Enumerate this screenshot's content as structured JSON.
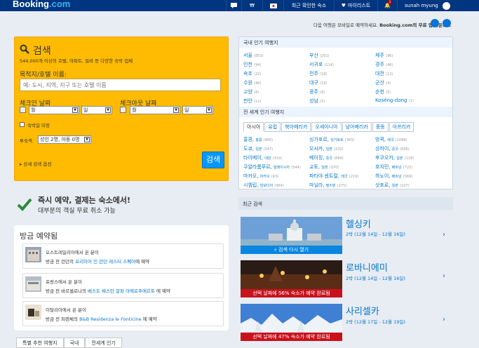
{
  "header": {
    "logo_main": "Booking",
    "logo_dot": ".com",
    "flag_icon": "🇰🇷",
    "currency": "₩",
    "recently_viewed": "최근 확인한 숙소",
    "wishlist": "마이리스트",
    "notif_count": "1",
    "user": "sunah myung"
  },
  "app_note": {
    "text_pre": "다음 여행은 모바일로 예약하세요. ",
    "brand": "Booking.com",
    "text_post": "의 무료 앱 다운로드"
  },
  "search": {
    "title": "검색",
    "subtitle": "544,000개 이상의 호텔, 아파트, 빌라 등 다양한 숙박 업체",
    "dest_label": "목적지/호텔 이름:",
    "dest_placeholder": "예: 도시, 지역, 지구 또는 호텔 이름",
    "checkin_label": "체크인 날짜",
    "checkout_label": "체크아웃 날짜",
    "month_sel": "월",
    "day_sel": "일",
    "undecided": "숙박일 미정",
    "guests_label": "투숙객",
    "guests_value": "성인 2명, 아동 0명",
    "advanced": "상세 검색 옵션",
    "button": "검색"
  },
  "promo": {
    "line1": "즉시 예약, 결제는 숙소에서!",
    "line2": "대부분의 객실 무료 취소 가능"
  },
  "recent_bookings": {
    "title": "방금 예약됨",
    "items": [
      {
        "origin": "오스트레일리아에서 온 분이",
        "pre": "방금 전 런던의 ",
        "link": "프리미어 인 런던 레스터 스퀘어",
        "post": "에 예약"
      },
      {
        "origin": "프랑스에서 온 분이",
        "pre": "방금 전 바르셀로나의 ",
        "link": "베스트 웨스턴 알파 아에로푸에르토",
        "post": " 에 예약"
      },
      {
        "origin": "이탈리아에서 온 분이",
        "pre": "방금 전 피렌체의 ",
        "link": "B&B Residenza le Fonticine",
        "post": " 에 예약"
      }
    ]
  },
  "bottom_tabs": [
    "특별 추천 여행지",
    "국내",
    "전세계 인기"
  ],
  "domestic": {
    "title": "국내 인기 여행지",
    "cities": [
      {
        "name": "서울",
        "count": "(853)"
      },
      {
        "name": "부산",
        "count": "(201)"
      },
      {
        "name": "제주",
        "count": "(96)"
      },
      {
        "name": "인천",
        "count": "(94)"
      },
      {
        "name": "서귀포",
        "count": "(114)"
      },
      {
        "name": "경주",
        "count": "(46)"
      },
      {
        "name": "속초",
        "count": "(22)"
      },
      {
        "name": "전주",
        "count": "(18)"
      },
      {
        "name": "대전",
        "count": "(12)"
      },
      {
        "name": "수원",
        "count": "(40)"
      },
      {
        "name": "대구",
        "count": "(19)"
      },
      {
        "name": "군산",
        "count": "(4)"
      },
      {
        "name": "고양",
        "count": "(8)"
      },
      {
        "name": "광주",
        "count": "(8)"
      },
      {
        "name": "순천",
        "count": "(5)"
      },
      {
        "name": "천안",
        "count": "(11)"
      },
      {
        "name": "성남",
        "count": "(5)"
      },
      {
        "name": "Koséng-dong",
        "count": "(1)"
      }
    ]
  },
  "world": {
    "title": "전 세계 인기 여행지",
    "tabs": [
      "아시아",
      "유럽",
      "북아메리카",
      "오세아니아",
      "남아메리카",
      "중동",
      "아프리카"
    ],
    "cities": [
      {
        "name": "홍콩,",
        "sub": "홍콩",
        "count": "(400)"
      },
      {
        "name": "싱가포르,",
        "sub": "싱가포르",
        "count": "(365)"
      },
      {
        "name": "방콕,",
        "sub": "태국",
        "count": "(1099)"
      },
      {
        "name": "도쿄,",
        "sub": "일본",
        "count": "(547)"
      },
      {
        "name": "오사카,",
        "sub": "일본",
        "count": "(232)"
      },
      {
        "name": "상하이,",
        "sub": "중국",
        "count": "(656)"
      },
      {
        "name": "타이베이,",
        "sub": "대만",
        "count": "(319)"
      },
      {
        "name": "베이징,",
        "sub": "중국",
        "count": "(664)"
      },
      {
        "name": "후쿠오카,",
        "sub": "일본",
        "count": "(118)"
      },
      {
        "name": "쿠알라룸푸르,",
        "sub": "말레이시아",
        "count": "(544)"
      },
      {
        "name": "교토,",
        "sub": "일본",
        "count": "(370)"
      },
      {
        "name": "호치민,",
        "sub": "베트남",
        "count": "(722)"
      },
      {
        "name": "마카오,",
        "sub": "마카오",
        "count": "(43)"
      },
      {
        "name": "파타야 센트럴,",
        "sub": "태국",
        "count": "(219)"
      },
      {
        "name": "하노이,",
        "sub": "베트남",
        "count": "(569)"
      },
      {
        "name": "시엠립,",
        "sub": "캄보디아",
        "count": "(464)"
      },
      {
        "name": "마닐라,",
        "sub": "필리핀",
        "count": "(275)"
      },
      {
        "name": "삿포로,",
        "sub": "일본",
        "count": "(107)"
      }
    ]
  },
  "recent_searches": {
    "title": "최근 검색",
    "cards": [
      {
        "city": "헬싱키",
        "date": "2박 (12월 14일 - 12월 16일)",
        "banner": "검색 다시 열기"
      },
      {
        "city": "로바니에미",
        "date": "2박 (12월 14일 - 12월 16일)",
        "banner": "선택 날짜에 56% 숙소가 예약 완료됨"
      },
      {
        "city": "사리셀카",
        "date": "2박 (12월 17일 - 12월 19일)",
        "banner": "선택 날짜에 47% 숙소가 예약 완료됨"
      }
    ]
  }
}
